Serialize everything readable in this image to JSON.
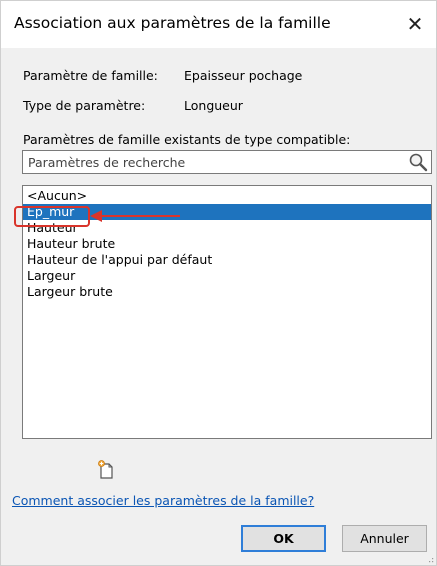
{
  "window": {
    "title": "Association aux paramètres de la famille",
    "close_glyph": "✕"
  },
  "fields": {
    "family_param_label": "Paramètre de famille:",
    "family_param_value": "Epaisseur pochage",
    "param_type_label": "Type de paramètre:",
    "param_type_value": "Longueur"
  },
  "compatible": {
    "label": "Paramètres de famille existants de type compatible:",
    "search_placeholder": "Paramètres de recherche",
    "items": [
      {
        "label": "<Aucun>",
        "selected": false
      },
      {
        "label": "Ep_mur",
        "selected": true
      },
      {
        "label": "Hauteur",
        "selected": false
      },
      {
        "label": "Hauteur brute",
        "selected": false
      },
      {
        "label": "Hauteur de l'appui par défaut",
        "selected": false
      },
      {
        "label": "Largeur",
        "selected": false
      },
      {
        "label": "Largeur brute",
        "selected": false
      }
    ]
  },
  "icons": {
    "search": "search-icon",
    "new_parameter": "new-parameter-icon",
    "close": "close-icon"
  },
  "help": {
    "link_text": "Comment associer les paramètres de la famille?"
  },
  "buttons": {
    "ok": "OK",
    "cancel": "Annuler"
  },
  "colors": {
    "selection": "#1e73be",
    "annotation": "#d9342b",
    "link": "#0a55b4",
    "default_button_border": "#2f7ed8"
  }
}
